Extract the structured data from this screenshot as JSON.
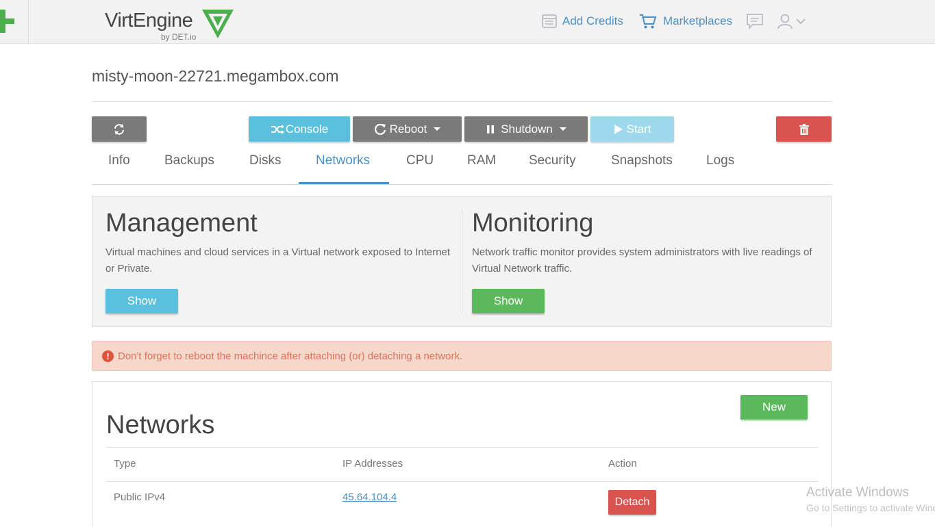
{
  "brand": {
    "name": "VirtEngine",
    "tagline": "by DET.io",
    "accent": "#4cae4c"
  },
  "header_nav": {
    "add_credits": "Add Credits",
    "marketplaces": "Marketplaces"
  },
  "host": {
    "title": "misty-moon-22721.megambox.com"
  },
  "toolbar": {
    "console": "Console",
    "reboot": "Reboot",
    "shutdown": "Shutdown",
    "start": "Start"
  },
  "tabs": [
    {
      "label": "Info"
    },
    {
      "label": "Backups"
    },
    {
      "label": "Disks"
    },
    {
      "label": "Networks",
      "active": true
    },
    {
      "label": "CPU"
    },
    {
      "label": "RAM"
    },
    {
      "label": "Security"
    },
    {
      "label": "Snapshots"
    },
    {
      "label": "Logs"
    }
  ],
  "features": {
    "management": {
      "title": "Management",
      "description": "Virtual machines and cloud services in a Virtual network exposed to Internet or Private.",
      "button": "Show"
    },
    "monitoring": {
      "title": "Monitoring",
      "description": "Network traffic monitor provides system administrators with live readings of Virtual Network traffic.",
      "button": "Show"
    }
  },
  "alert": {
    "icon": "exclamation-circle-icon",
    "text": "Don't forget to reboot the machince after attaching (or) detaching a network."
  },
  "networks": {
    "title": "Networks",
    "new_button": "New",
    "columns": [
      "Type",
      "IP Addresses",
      "Action"
    ],
    "rows": [
      {
        "type": "Public IPv4",
        "ip": "45.64.104.4",
        "action": "Detach"
      }
    ]
  },
  "watermark": {
    "line1": "Activate Windows",
    "line2": "Go to Settings to activate Windows."
  }
}
